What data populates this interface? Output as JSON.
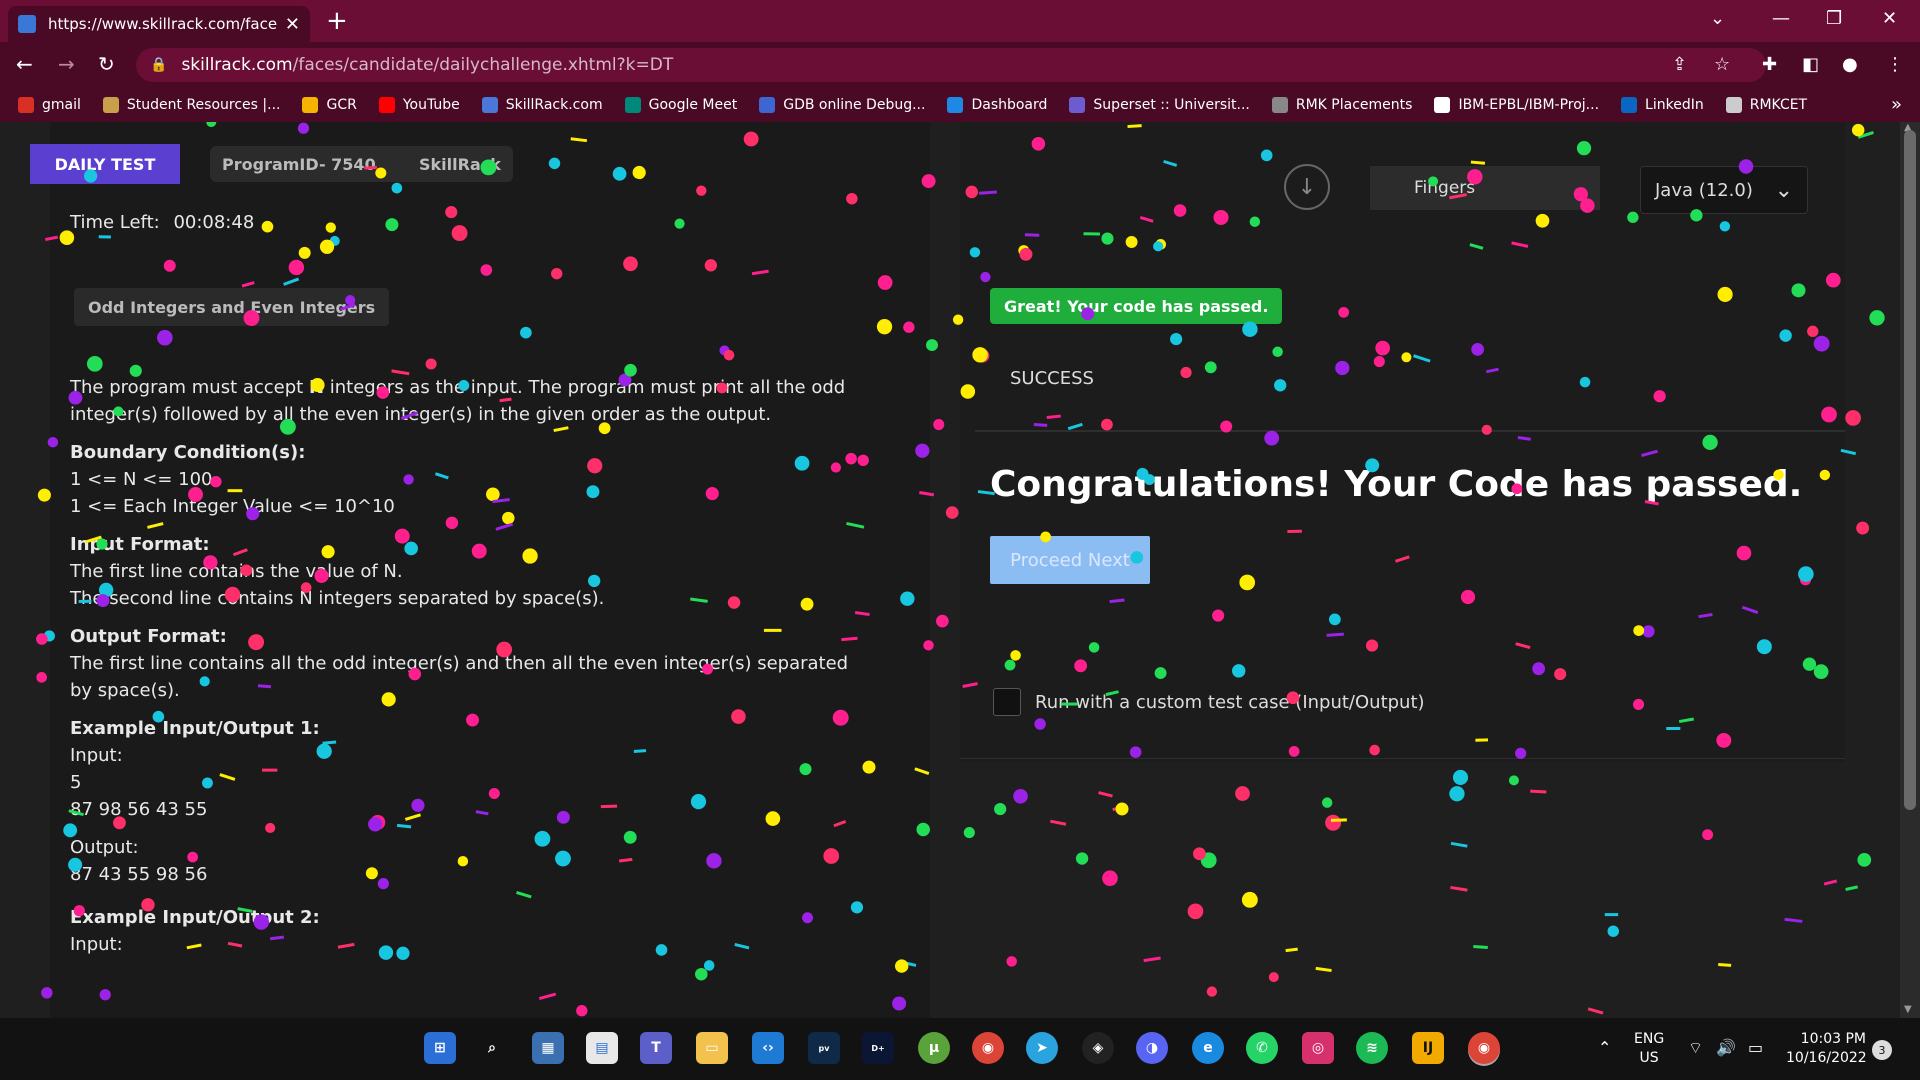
{
  "browser": {
    "tab_title": "https://www.skillrack.com/faces/c",
    "url_host": "skillrack.com",
    "url_path": "/faces/candidate/dailychallenge.xhtml?k=DT",
    "bookmarks": [
      {
        "label": "gmail",
        "color": "#d93025"
      },
      {
        "label": "Student Resources |...",
        "color": "#c9a04a"
      },
      {
        "label": "GCR",
        "color": "#f4b400"
      },
      {
        "label": "YouTube",
        "color": "#ff0000"
      },
      {
        "label": "SkillRack.com",
        "color": "#4a78d8"
      },
      {
        "label": "Google Meet",
        "color": "#00897b"
      },
      {
        "label": "GDB online Debug...",
        "color": "#3e66d1"
      },
      {
        "label": "Dashboard",
        "color": "#1e88e5"
      },
      {
        "label": "Superset :: Universit...",
        "color": "#6d5bd0"
      },
      {
        "label": "RMK Placements",
        "color": "#888888"
      },
      {
        "label": "IBM-EPBL/IBM-Proj...",
        "color": "#ffffff"
      },
      {
        "label": "LinkedIn",
        "color": "#0a66c2"
      },
      {
        "label": "RMKCET",
        "color": "#cccccc"
      }
    ]
  },
  "header": {
    "daily_test": "DAILY TEST",
    "program_id": "ProgramID- 7540",
    "brand": "SkillRack",
    "time_left_label": "Time Left:",
    "time_left_value": "00:08:48"
  },
  "problem": {
    "title": "Odd Integers and Even Integers",
    "intro_pre": "The program must accept ",
    "intro_bold": "N",
    "intro_post": " integers as the input. The program must print all the odd integer(s) followed by all the even integer(s) in the given order as the output.",
    "boundary_heading": "Boundary Condition(s):",
    "boundary_1": "1 <= N <= 100",
    "boundary_2": "1 <= Each Integer Value <= 10^10",
    "input_heading": "Input Format:",
    "input_1": "The first line contains the value of N.",
    "input_2": "The second line contains N integers separated by space(s).",
    "output_heading": "Output Format:",
    "output_1": "The first line contains all the odd integer(s) and then all the even integer(s) separated by space(s).",
    "example1_heading": "Example Input/Output 1:",
    "input_label": "Input:",
    "example1_in_1": "5",
    "example1_in_2": "87 98 56 43 55",
    "output_label": "Output:",
    "example1_out": "87 43 55 98 56",
    "example2_heading": "Example Input/Output 2:",
    "input_label_2": "Input:"
  },
  "editor": {
    "theme_value": "Fingers",
    "language_value": "Java (12.0)",
    "passed_badge": "Great! Your code has passed.",
    "success_text": "SUCCESS",
    "congrats": "Congratulations! Your Code has passed.",
    "proceed_label": "Proceed Next",
    "custom_test_label": "Run with a custom test case (Input/Output)"
  },
  "taskbar": {
    "lang_1": "ENG",
    "lang_2": "US",
    "time": "10:03 PM",
    "date": "10/16/2022",
    "notifications": "3"
  },
  "colors": {
    "chrome_dark": "#4a0a25",
    "chrome_light": "#6b0e35",
    "accent_purple": "#5a3fd0",
    "success_green": "#1fae3c",
    "proceed_blue": "#8cbdf2"
  }
}
